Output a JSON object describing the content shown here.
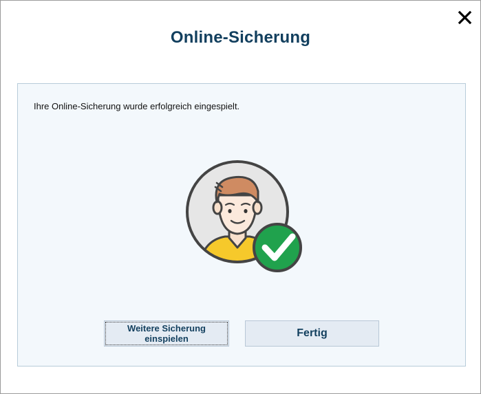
{
  "dialog": {
    "title": "Online-Sicherung",
    "close_icon": "close-icon"
  },
  "panel": {
    "message": "Ihre Online-Sicherung wurde erfolgreich eingespielt.",
    "illustration_icon": "user-avatar-with-checkmark-icon"
  },
  "buttons": {
    "more_label": "Weitere Sicherung einspielen",
    "done_label": "Fertig"
  },
  "colors": {
    "title": "#123f5e",
    "panel_bg": "#f3f8fc",
    "button_bg": "#e4ebf3",
    "check_green": "#20a24d"
  }
}
